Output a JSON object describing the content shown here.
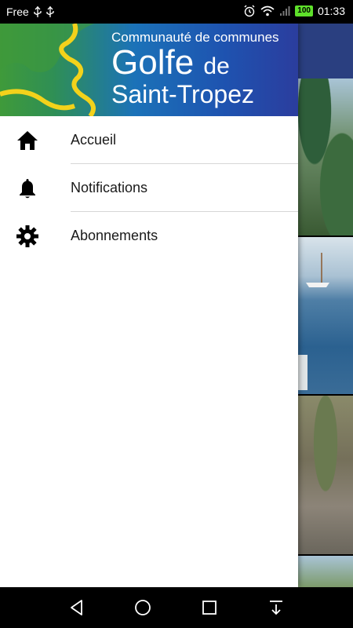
{
  "status_bar": {
    "carrier": "Free",
    "battery": "100",
    "time": "01:33"
  },
  "header": {
    "line1": "Communauté de communes",
    "line2_main": "Golfe",
    "line2_small": "de",
    "line3": "Saint-Tropez"
  },
  "menu": {
    "items": [
      {
        "label": "Accueil",
        "icon": "home-icon"
      },
      {
        "label": "Notifications",
        "icon": "bell-icon"
      },
      {
        "label": "Abonnements",
        "icon": "gear-icon"
      }
    ]
  },
  "colors": {
    "header_blue": "#1e53b0",
    "header_green": "#3f9a3a",
    "logo_yellow": "#f3d21b"
  }
}
